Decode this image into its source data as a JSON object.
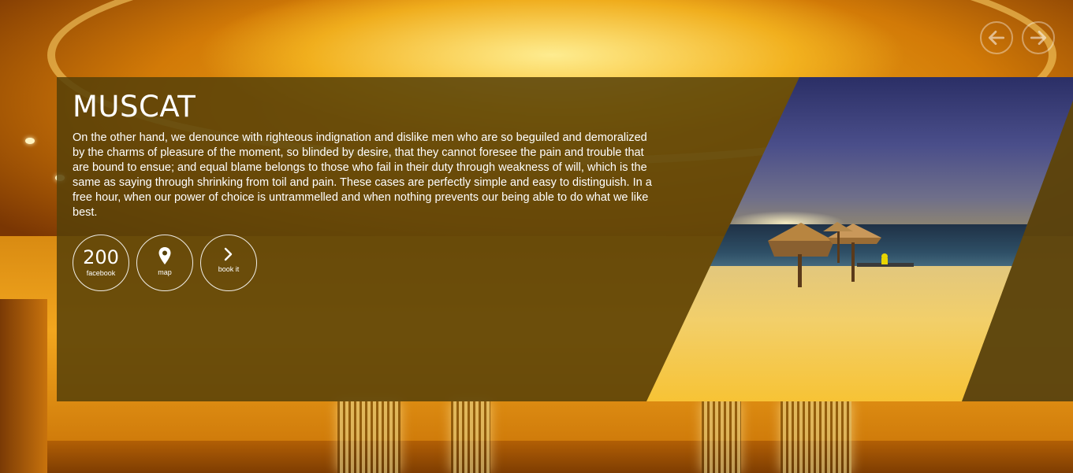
{
  "slide": {
    "title": "MUSCAT",
    "description": "On the other hand, we denounce with righteous indignation and dislike men who are so beguiled and demoralized by the charms of pleasure of the moment, so blinded by desire, that they cannot foresee the pain and trouble that are bound to ensue; and equal blame belongs to those who fail in their duty through weakness of will, which is the same as saying through shrinking from toil and pain. These cases are perfectly simple and easy to distinguish. In a free hour, when our power of choice is untrammelled and when nothing prevents our being able to do what we like best.",
    "actions": {
      "facebook": {
        "count": "200",
        "label": "facebook",
        "icon": "facebook-count"
      },
      "map": {
        "label": "map",
        "icon": "map-pin-icon"
      },
      "book": {
        "label": "book it",
        "icon": "chevron-right-icon"
      }
    }
  },
  "navigation": {
    "prev_icon": "arrow-left-icon",
    "next_icon": "arrow-right-icon"
  },
  "colors": {
    "panel_overlay": "#564008",
    "background_gold": "#f2a61e",
    "text": "#ffffff"
  }
}
